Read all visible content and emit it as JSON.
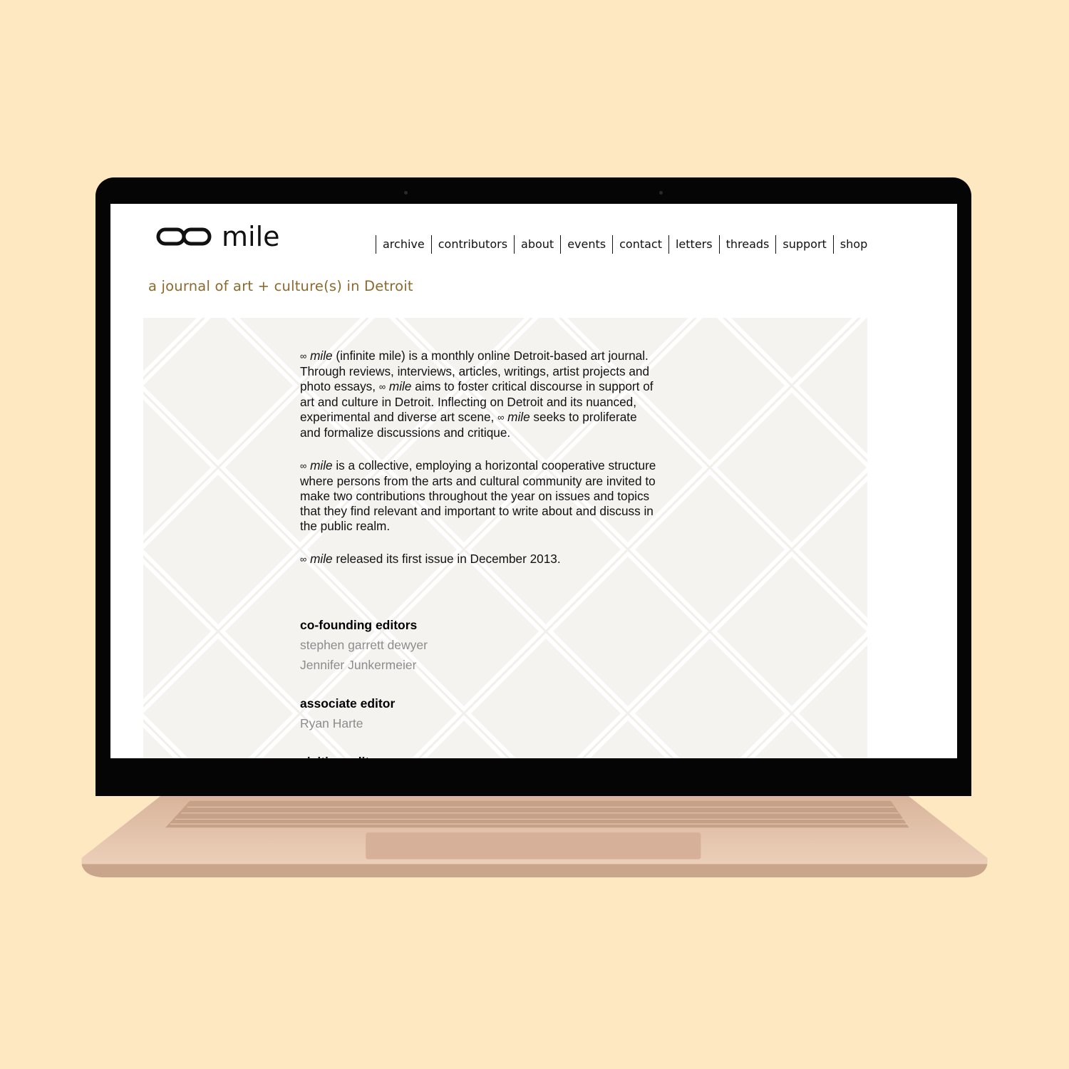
{
  "site": {
    "logo_text": "mile",
    "tagline": "a journal of art + culture(s) in Detroit"
  },
  "nav": {
    "items": [
      "archive",
      "contributors",
      "about",
      "events",
      "contact",
      "letters",
      "threads",
      "support",
      "shop"
    ]
  },
  "about": {
    "symbol": "∞",
    "brand": "mile",
    "p1_a": " (infinite mile) is a monthly online Detroit-based art journal.  Through reviews, interviews, articles, writings, artist projects and photo essays, ",
    "p1_b": " aims to foster critical discourse in support of art and culture in Detroit.  Inflecting on Detroit and its nuanced, experimental and diverse art scene, ",
    "p1_c": " seeks to proliferate and formalize discussions and critique.",
    "p2": " is a collective, employing a horizontal cooperative structure where persons from the arts and cultural community are invited to make two contributions throughout the year on issues and topics that they find relevant and important to write about and discuss in the public realm.",
    "p3": " released its first issue in December 2013."
  },
  "credits": {
    "cofounding_heading": "co-founding editors",
    "cofounding_names": [
      "stephen garrett dewyer",
      "Jennifer Junkermeier"
    ],
    "associate_heading": "associate editor",
    "associate_names": [
      "Ryan Harte"
    ],
    "visiting_heading": "visiting editor"
  },
  "colors": {
    "page_background": "#fde8c2",
    "tagline": "#8b6a2e",
    "names": "#8c8c8c",
    "laptop_body": "#e8c9b2"
  }
}
